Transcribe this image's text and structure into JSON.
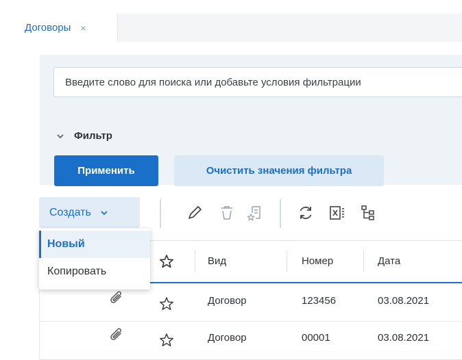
{
  "tabs": [
    {
      "label": "Договоры",
      "close": "×"
    }
  ],
  "search": {
    "placeholder": "Введите слово для поиска или добавьте условия фильтрации"
  },
  "filter": {
    "label": "Фильтр",
    "apply_label": "Применить",
    "clear_label": "Очистить значения фильтра"
  },
  "toolbar": {
    "create_label": "Создать",
    "icons": [
      "pencil-icon",
      "trash-icon",
      "document-star-icon",
      "refresh-icon",
      "excel-export-icon",
      "hierarchy-icon"
    ]
  },
  "create_menu": {
    "items": [
      "Новый",
      "Копировать"
    ],
    "selected": "Новый"
  },
  "grid": {
    "columns": [
      "Вид",
      "Номер",
      "Дата"
    ],
    "rows": [
      {
        "type": "Договор",
        "number": "123456",
        "date": "03.08.2021"
      },
      {
        "type": "Договор",
        "number": "00001",
        "date": "03.08.2021"
      }
    ]
  },
  "colors": {
    "accent": "#1a6fc9",
    "panel": "#eef3f8",
    "button_light": "#dbe8f5"
  }
}
